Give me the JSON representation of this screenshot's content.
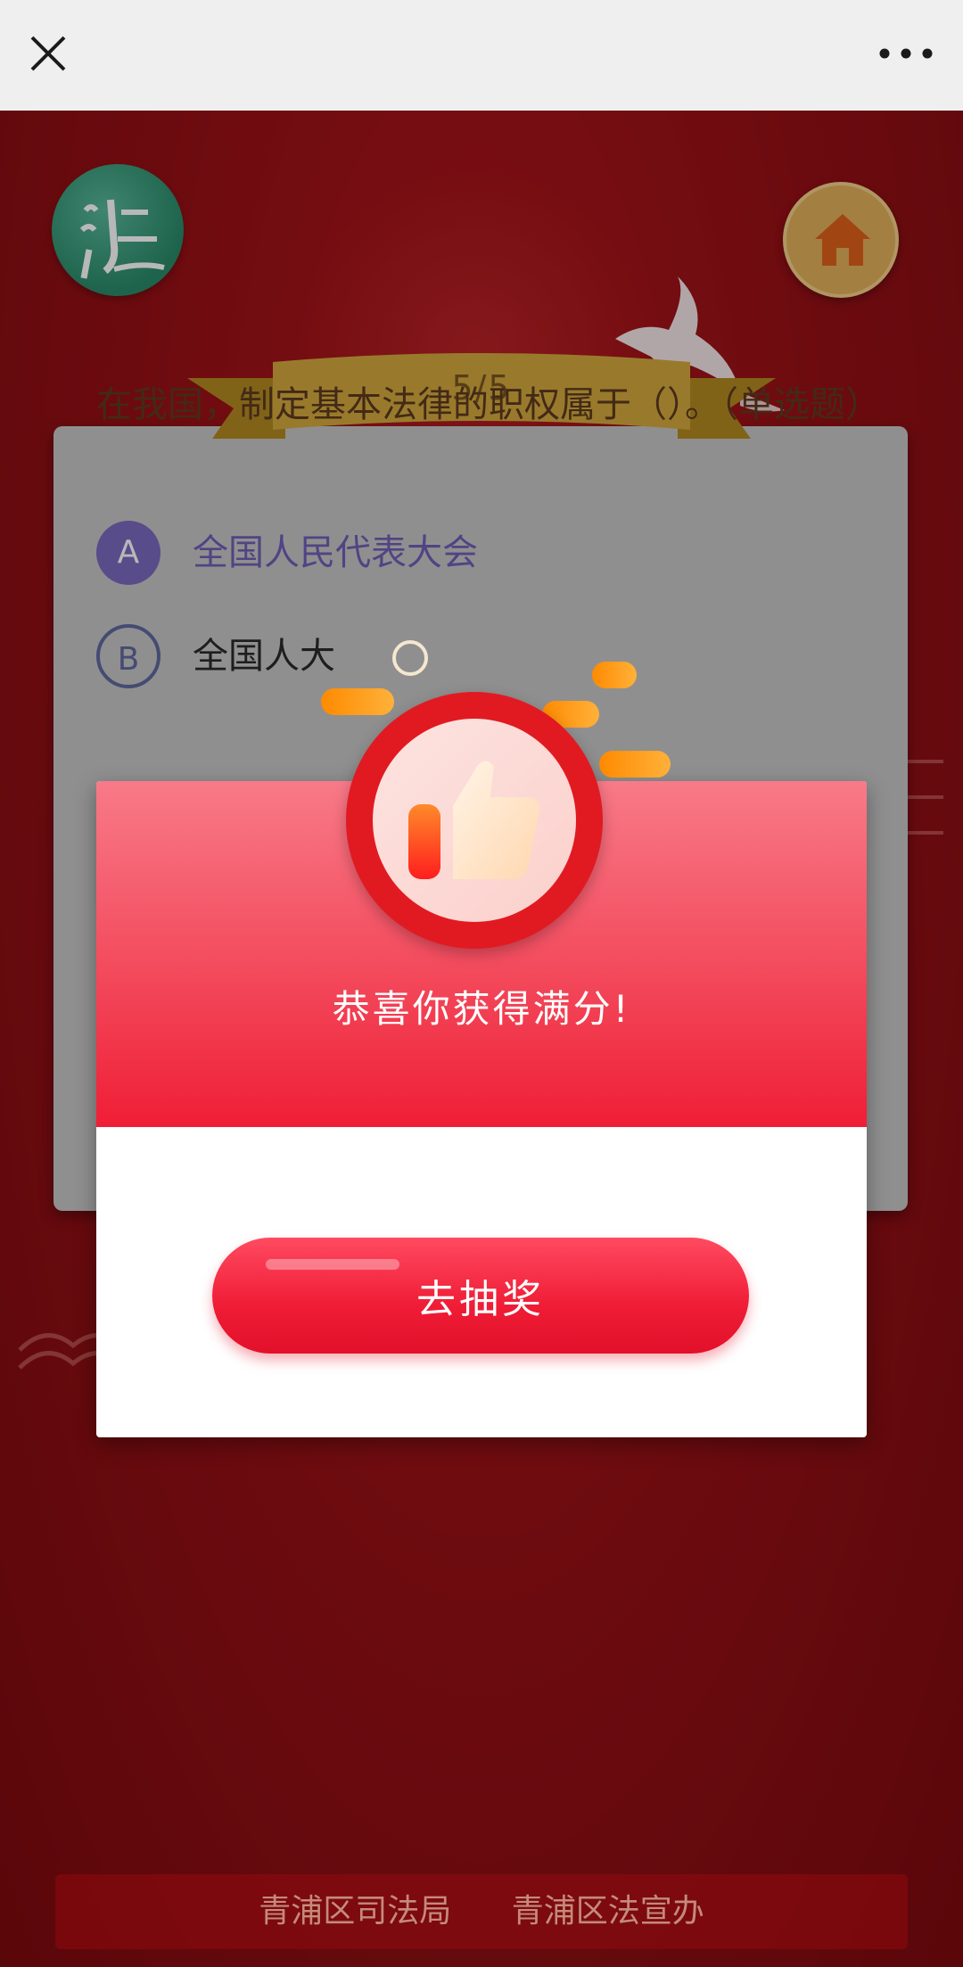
{
  "top_bar": {
    "close_icon": "close-icon",
    "more_icon": "more-icon"
  },
  "header": {
    "logo_icon": "law-logo-icon",
    "home_icon": "home-icon",
    "progress": "5/5"
  },
  "question": {
    "text": "在我国，制定基本法律的职权属于（）。（单选题）",
    "options": [
      {
        "letter": "A",
        "text": "全国人民代表大会"
      },
      {
        "letter": "B",
        "text": "全国人大"
      }
    ]
  },
  "modal": {
    "icon": "thumbs-up-icon",
    "title": "恭喜你获得满分!",
    "button_label": "去抽奖"
  },
  "footer": {
    "org1": "青浦区司法局",
    "org2": "青浦区法宣办"
  },
  "colors": {
    "background_red": "#8a0f14",
    "modal_red": "#ef1e36",
    "card_gray": "#c8c6c7",
    "option_purple": "#6f5fb8"
  }
}
